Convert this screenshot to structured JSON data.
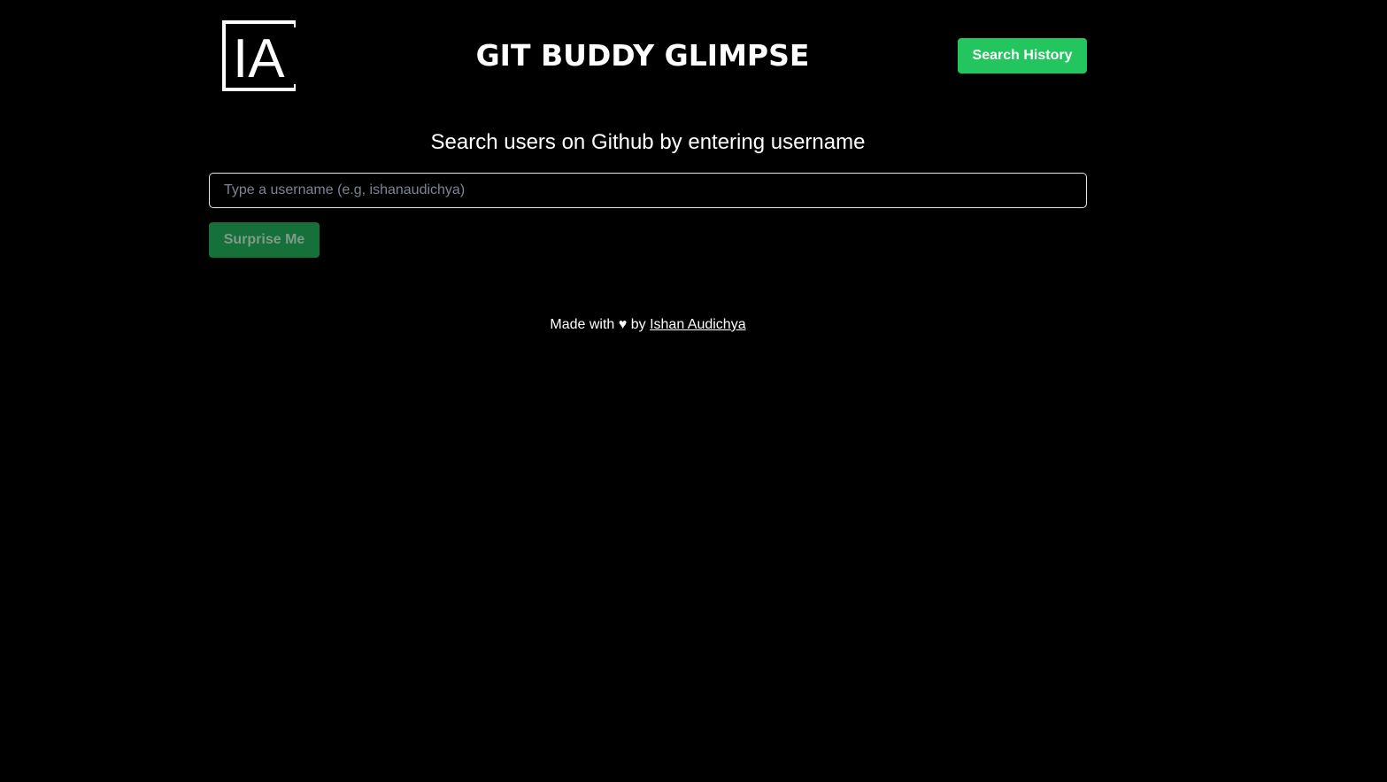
{
  "header": {
    "logo_text": "IA",
    "title": "GIT BUDDY GLIMPSE",
    "history_button_label": "Search History"
  },
  "main": {
    "subtitle": "Search users on Github by entering username",
    "search": {
      "value": "",
      "placeholder": "Type a username (e.g, ishanaudichya)"
    },
    "surprise_button_label": "Surprise Me"
  },
  "footer": {
    "prefix": "Made with",
    "heart": "♥",
    "by": "by",
    "author": "Ishan Audichya"
  },
  "colors": {
    "background": "#000000",
    "accent": "#22c55e",
    "accent_disabled": "#15703a"
  },
  "icons": {
    "logo": "ia-logo-icon",
    "heart": "heart-icon"
  }
}
